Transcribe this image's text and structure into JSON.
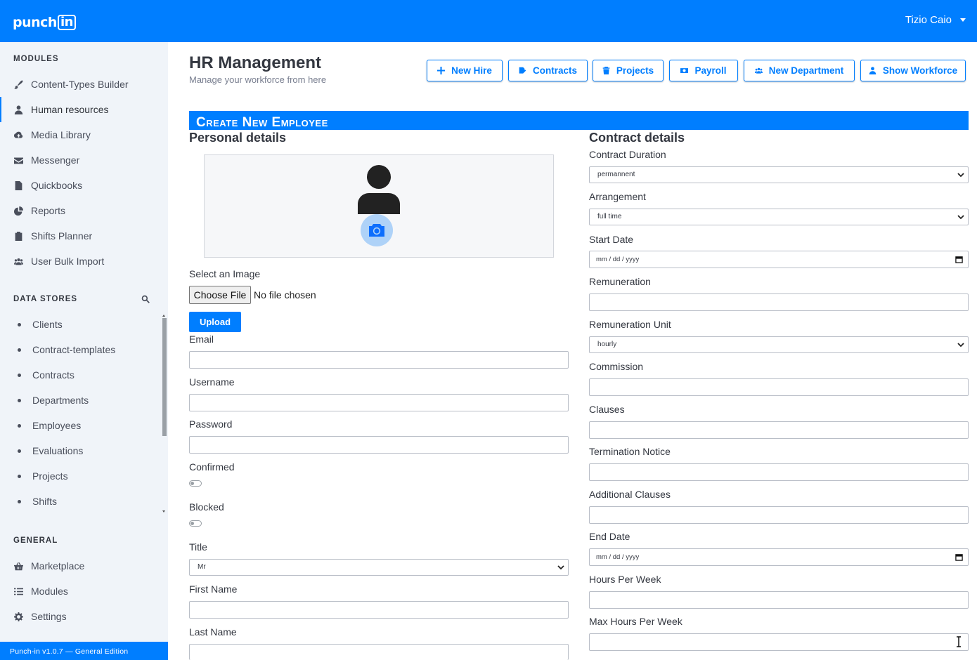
{
  "app": {
    "logo_text": "punch",
    "logo_box_text": "in",
    "user_name": "Tizio Caio",
    "footer": "Punch-in v1.0.7 — General Edition"
  },
  "sidebar": {
    "modules_heading": "MODULES",
    "modules": [
      {
        "label": "Content-Types Builder",
        "icon": "paint-brush-icon"
      },
      {
        "label": "Human resources",
        "icon": "user-icon",
        "active": true
      },
      {
        "label": "Media Library",
        "icon": "cloud-upload-icon"
      },
      {
        "label": "Messenger",
        "icon": "envelope-icon"
      },
      {
        "label": "Quickbooks",
        "icon": "file-icon"
      },
      {
        "label": "Reports",
        "icon": "pie-chart-icon"
      },
      {
        "label": "Shifts Planner",
        "icon": "clipboard-icon"
      },
      {
        "label": "User Bulk Import",
        "icon": "users-icon"
      }
    ],
    "datastores_heading": "DATA STORES",
    "datastores": [
      "Clients",
      "Contract-templates",
      "Contracts",
      "Departments",
      "Employees",
      "Evaluations",
      "Projects",
      "Shifts"
    ],
    "general_heading": "GENERAL",
    "general": [
      {
        "label": "Marketplace",
        "icon": "shopping-basket-icon"
      },
      {
        "label": "Modules",
        "icon": "list-icon"
      },
      {
        "label": "Settings",
        "icon": "gear-icon"
      }
    ]
  },
  "header": {
    "title": "HR Management",
    "subtitle": "Manage your workforce from here",
    "buttons": [
      {
        "label": "New Hire",
        "icon": "plus-icon"
      },
      {
        "label": "Contracts",
        "icon": "file-signature-icon"
      },
      {
        "label": "Projects",
        "icon": "trash-icon"
      },
      {
        "label": "Payroll",
        "icon": "money-bill-icon"
      },
      {
        "label": "New Department",
        "icon": "users-icon"
      },
      {
        "label": "Show Workforce",
        "icon": "user-icon"
      }
    ]
  },
  "form": {
    "banner": "Create New Employee",
    "personal": {
      "title": "Personal details",
      "select_image_label": "Select an Image",
      "choose_file": "Choose File",
      "no_file": "No file chosen",
      "upload": "Upload",
      "email_label": "Email",
      "username_label": "Username",
      "password_label": "Password",
      "confirmed_label": "Confirmed",
      "confirmed_value": false,
      "blocked_label": "Blocked",
      "blocked_value": false,
      "title_label": "Title",
      "title_value": "Mr",
      "first_name_label": "First Name",
      "last_name_label": "Last Name"
    },
    "contract": {
      "title": "Contract details",
      "duration_label": "Contract Duration",
      "duration_value": "permannent",
      "arrangement_label": "Arrangement",
      "arrangement_value": "full time",
      "start_date_label": "Start Date",
      "start_date_placeholder": "mm / dd / yyyy",
      "remuneration_label": "Remuneration",
      "remuneration_unit_label": "Remuneration Unit",
      "remuneration_unit_value": "hourly",
      "commission_label": "Commission",
      "clauses_label": "Clauses",
      "termination_label": "Termination Notice",
      "additional_clauses_label": "Additional Clauses",
      "end_date_label": "End Date",
      "end_date_placeholder": "mm / dd / yyyy",
      "hours_per_week_label": "Hours Per Week",
      "max_hours_label": "Max Hours Per Week"
    }
  },
  "colors": {
    "accent": "#007eff",
    "sidebar_bg": "#f0f4f9",
    "text": "#333740"
  }
}
